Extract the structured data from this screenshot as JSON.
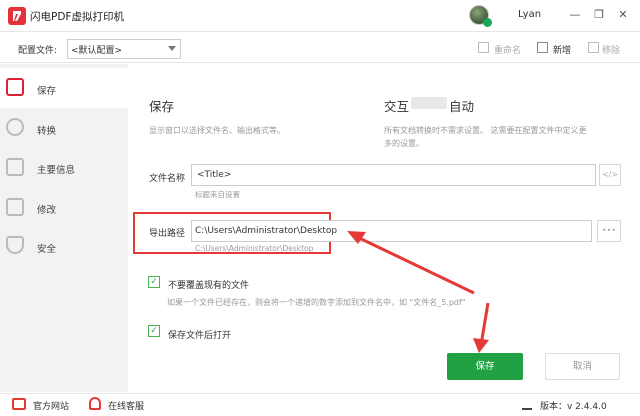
{
  "app": {
    "title": "闪电PDF虚拟打印机",
    "user": "Lyan"
  },
  "window": {
    "minimize": "—",
    "restore": "❐",
    "close": "✕"
  },
  "config": {
    "label": "配置文件:",
    "selected": "<默认配置>",
    "rename": "重命名",
    "new": "新增",
    "delete": "移除"
  },
  "sidebar": {
    "items": [
      {
        "label": "保存",
        "icon": "save-icon"
      },
      {
        "label": "转换",
        "icon": "convert-icon"
      },
      {
        "label": "主要信息",
        "icon": "info-icon"
      },
      {
        "label": "修改",
        "icon": "edit-icon"
      },
      {
        "label": "安全",
        "icon": "shield-icon"
      }
    ]
  },
  "main": {
    "save_title": "保存",
    "save_desc": "显示窗口以选择文件名、输出格式等。",
    "interactive_title_left": "交互",
    "interactive_title_right": "自动",
    "interactive_desc_1": "所有文档转换时不需求设置。 这需要在配置文件中定义更",
    "interactive_desc_2": "多的设置。",
    "filename_label": "文件名称",
    "filename_value": "<Title>",
    "filename_hint": "标题来自设置",
    "filename_btn": "</>",
    "path_label": "导出路径",
    "path_value": "C:\\Users\\Administrator\\Desktop",
    "path_hint": "C:\\Users\\Administrator\\Desktop",
    "path_btn": "•••",
    "no_overwrite_label": "不要覆盖现有的文件",
    "no_overwrite_desc": "如果一个文件已经存在，则会将一个递增的数字添加到文件名中，如 \"文件名_5.pdf\"",
    "open_after_label": "保存文件后打开",
    "check_mark": "✓",
    "save_button": "保存",
    "cancel_button": "取消"
  },
  "footer": {
    "website": "官方网站",
    "support": "在线客服",
    "version": "版本：v 2.4.4.0"
  },
  "colors": {
    "accent": "#21a144",
    "highlight": "#e53935",
    "brand": "#e5323a"
  }
}
